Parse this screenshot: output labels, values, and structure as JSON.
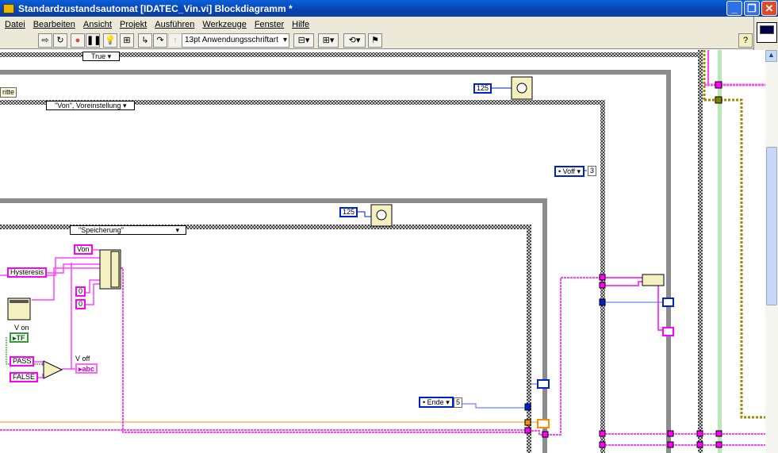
{
  "window": {
    "title": "Standardzustandsautomat [IDATEC_Vin.vi] Blockdiagramm *",
    "minimize": "_",
    "restore": "❐",
    "close": "✕"
  },
  "menu": [
    "Datei",
    "Bearbeiten",
    "Ansicht",
    "Projekt",
    "Ausführen",
    "Werkzeuge",
    "Fenster",
    "Hilfe"
  ],
  "toolbar": {
    "font": "13pt Anwendungsschriftart",
    "help": "?"
  },
  "diagram": {
    "case_true": "True",
    "label_ritte": "ritte",
    "case_von": "\"Von\", Voreinstellung",
    "wait_outer": "125",
    "enum_voff": "Voff",
    "enum_voff_val": "3",
    "wait_inner": "125",
    "case_speicherung": "\"Speicherung\"",
    "const_von": "Von",
    "const_hysteresis": "Hysteresis",
    "const_zero1": "0",
    "const_zero2": "0",
    "label_von": "V on",
    "ind_von": "TF",
    "const_pass": "PASS",
    "const_false": "FALSE",
    "label_voff": "V off",
    "ind_voff": "abc",
    "enum_ende": "Ende",
    "enum_ende_val": "5"
  },
  "colors": {
    "string_wire": "#ff00ff",
    "enum_wire": "#0022cc",
    "orange_wire": "#ff8c00",
    "titlebar": "#0842b0"
  }
}
